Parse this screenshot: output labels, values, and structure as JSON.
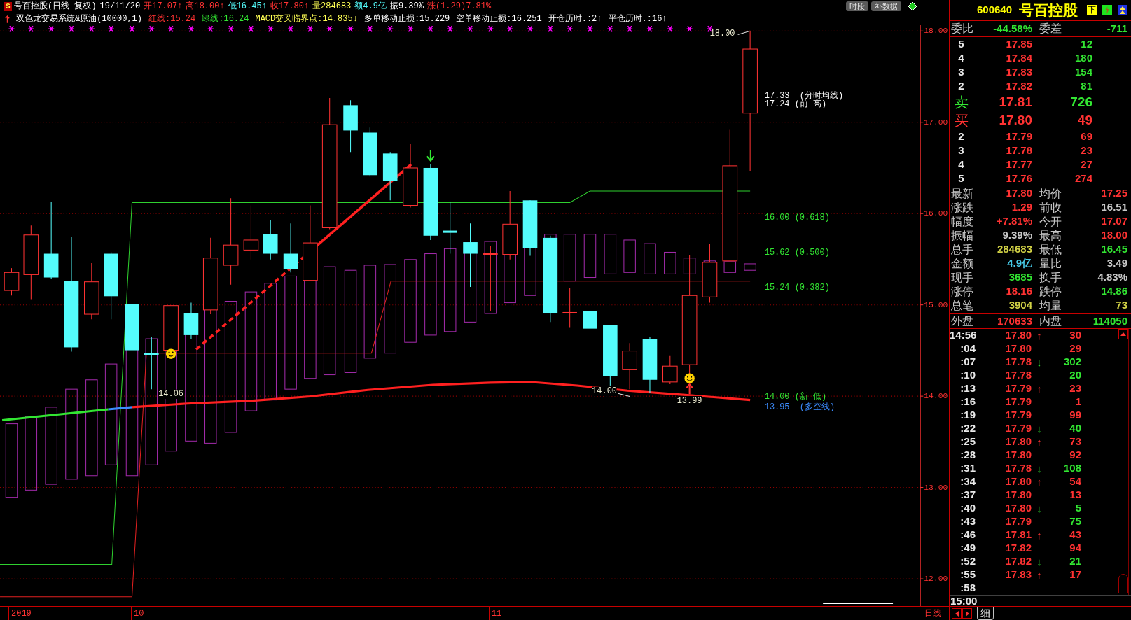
{
  "chart_header": {
    "badge": "S",
    "quote_line": [
      {
        "text": "号百控股(日线 复权)"
      },
      {
        "text": "19/11/20",
        "color": "#ffffff"
      },
      {
        "text": "开17.07↑",
        "color": "#ff3232"
      },
      {
        "text": "高18.00↑",
        "color": "#ff3232"
      },
      {
        "text": "低16.45↑",
        "color": "#54fcfc"
      },
      {
        "text": "收17.80↑",
        "color": "#ff3232"
      },
      {
        "text": "量284683",
        "color": "#ffff54"
      },
      {
        "text": "额4.9亿",
        "color": "#54fcfc"
      },
      {
        "text": "振9.39%",
        "color": "#ffffff"
      },
      {
        "text": "涨(1.29)7.81%",
        "color": "#ff3232"
      }
    ],
    "indicator_line": [
      {
        "text": "双色龙交易系统&原油(10000,1)",
        "color": "#ffffff"
      },
      {
        "text": "红线:15.24",
        "color": "#ff3232"
      },
      {
        "text": "绿线:16.24",
        "color": "#32e632"
      },
      {
        "text": "MACD交叉临界点:14.835↓",
        "color": "#ffff54"
      },
      {
        "text": "多单移动止损:15.229",
        "color": "#ffffff"
      },
      {
        "text": "空单移动止损:16.251",
        "color": "#ffffff"
      },
      {
        "text": "开仓历时.:2↑",
        "color": "#ffffff"
      },
      {
        "text": "平仓历时.:16↑",
        "color": "#ffffff"
      }
    ],
    "buttons": [
      "时段",
      "补数据"
    ]
  },
  "price_axis": [
    "18.00",
    "17.00",
    "16.00",
    "15.00",
    "14.00",
    "13.00",
    "12.00"
  ],
  "price_levels": [
    {
      "text": "17.33  (分时均线)",
      "color": "#ffffff"
    },
    {
      "text": "17.24 (前 高)",
      "color": "#ffffff"
    },
    {
      "text": "16.00 (0.618)",
      "color": "#32e632"
    },
    {
      "text": "15.62 (0.500)",
      "color": "#32e632"
    },
    {
      "text": "15.24 (0.382)",
      "color": "#32e632"
    },
    {
      "text": "14.00 (新 低)",
      "color": "#32e632"
    },
    {
      "text": "13.95  (多空线)",
      "color": "#3c8cff"
    }
  ],
  "point_labels": [
    "18.00",
    "14.06",
    "14.00",
    "13.99"
  ],
  "date_axis": [
    "2019",
    "10",
    "11"
  ],
  "period": "日线",
  "quote": {
    "code": "600640",
    "name": "号百控股",
    "badge": "下",
    "ratio": {
      "label": "委比",
      "value": "-44.58%"
    },
    "diff": {
      "label": "委差",
      "value": "-711"
    },
    "asks": [
      {
        "kind": "level",
        "level": "5",
        "price": "17.85",
        "volume": "12"
      },
      {
        "kind": "level",
        "level": "4",
        "price": "17.84",
        "volume": "180"
      },
      {
        "kind": "level",
        "level": "3",
        "price": "17.83",
        "volume": "154"
      },
      {
        "kind": "level",
        "level": "2",
        "price": "17.82",
        "volume": "81"
      },
      {
        "kind": "best",
        "level": "卖",
        "price": "17.81",
        "volume": "726"
      }
    ],
    "bids": [
      {
        "kind": "best",
        "level": "买",
        "price": "17.80",
        "volume": "49"
      },
      {
        "kind": "level",
        "level": "2",
        "price": "17.79",
        "volume": "69"
      },
      {
        "kind": "level",
        "level": "3",
        "price": "17.78",
        "volume": "23"
      },
      {
        "kind": "level",
        "level": "4",
        "price": "17.77",
        "volume": "27"
      },
      {
        "kind": "level",
        "level": "5",
        "price": "17.76",
        "volume": "274"
      }
    ],
    "stats": [
      {
        "label": "最新",
        "value": "17.80",
        "color": "#ff3232"
      },
      {
        "label": "均价",
        "value": "17.25",
        "color": "#ff3232"
      },
      {
        "label": "涨跌",
        "value": "1.29",
        "color": "#ff3232"
      },
      {
        "label": "前收",
        "value": "16.51",
        "color": "#c8c8c8"
      },
      {
        "label": "幅度",
        "value": "+7.81%",
        "color": "#ff3232"
      },
      {
        "label": "今开",
        "value": "17.07",
        "color": "#ff3232"
      },
      {
        "label": "振幅",
        "value": "9.39%",
        "color": "#c8c8c8"
      },
      {
        "label": "最高",
        "value": "18.00",
        "color": "#ff3232"
      },
      {
        "label": "总手",
        "value": "284683",
        "color": "#d2d246"
      },
      {
        "label": "最低",
        "value": "16.45",
        "color": "#32e632"
      },
      {
        "label": "金额",
        "value": "4.9亿",
        "color": "#46c8e6"
      },
      {
        "label": "量比",
        "value": "3.49",
        "color": "#c8c8c8"
      },
      {
        "label": "现手",
        "value": "3685",
        "color": "#32e632"
      },
      {
        "label": "换手",
        "value": "4.83%",
        "color": "#c8c8c8"
      },
      {
        "label": "涨停",
        "value": "18.16",
        "color": "#ff3232"
      },
      {
        "label": "跌停",
        "value": "14.86",
        "color": "#32e632"
      },
      {
        "label": "总笔",
        "value": "3904",
        "color": "#d2d246"
      },
      {
        "label": "均量",
        "value": "73",
        "color": "#d2d246"
      }
    ],
    "outer": {
      "label": "外盘",
      "value": "170633"
    },
    "inner": {
      "label": "内盘",
      "value": "114050"
    }
  },
  "ticks": [
    {
      "time": "14:56",
      "price": "17.80",
      "arrow": "↑",
      "volume": "30",
      "color": "#ff3232"
    },
    {
      "time": ":04",
      "price": "17.80",
      "volume": "29",
      "color": "#ff3232"
    },
    {
      "time": ":07",
      "price": "17.78",
      "arrow": "↓",
      "volume": "302",
      "color": "#32e632"
    },
    {
      "time": ":10",
      "price": "17.78",
      "volume": "20",
      "color": "#32e632"
    },
    {
      "time": ":13",
      "price": "17.79",
      "arrow": "↑",
      "volume": "23",
      "color": "#ff3232"
    },
    {
      "time": ":16",
      "price": "17.79",
      "volume": "1",
      "color": "#ff3232"
    },
    {
      "time": ":19",
      "price": "17.79",
      "volume": "99",
      "color": "#ff3232"
    },
    {
      "time": ":22",
      "price": "17.79",
      "arrow": "↓",
      "volume": "40",
      "color": "#32e632"
    },
    {
      "time": ":25",
      "price": "17.80",
      "arrow": "↑",
      "volume": "73",
      "color": "#ff3232"
    },
    {
      "time": ":28",
      "price": "17.80",
      "volume": "92",
      "color": "#ff3232"
    },
    {
      "time": ":31",
      "price": "17.78",
      "arrow": "↓",
      "volume": "108",
      "color": "#32e632"
    },
    {
      "time": ":34",
      "price": "17.80",
      "arrow": "↑",
      "volume": "54",
      "color": "#ff3232"
    },
    {
      "time": ":37",
      "price": "17.80",
      "volume": "13",
      "color": "#ff3232"
    },
    {
      "time": ":40",
      "price": "17.80",
      "arrow": "↓",
      "volume": "5",
      "color": "#32e632"
    },
    {
      "time": ":43",
      "price": "17.79",
      "volume": "75",
      "color": "#32e632"
    },
    {
      "time": ":46",
      "price": "17.81",
      "arrow": "↑",
      "volume": "43",
      "color": "#ff3232"
    },
    {
      "time": ":49",
      "price": "17.82",
      "volume": "94",
      "color": "#ff3232"
    },
    {
      "time": ":52",
      "price": "17.82",
      "arrow": "↓",
      "volume": "21",
      "color": "#32e632"
    },
    {
      "time": ":55",
      "price": "17.83",
      "arrow": "↑",
      "volume": "17",
      "color": "#ff3232"
    },
    {
      "time": ":58"
    }
  ],
  "close_time": "15:00",
  "detail_tab": "细"
}
